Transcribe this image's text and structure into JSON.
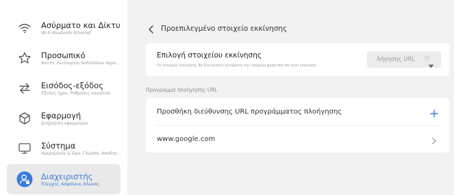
{
  "sidebar": {
    "items": [
      {
        "title": "Ασύρματο και Δίκτυο",
        "subtitle": "Wi-Fi Bluetooth Ethernet",
        "icon": "wifi-icon"
      },
      {
        "title": "Προσωπικό",
        "subtitle": "Φόντο, Λειτουργία πολλαπλών παρα...",
        "icon": "star-icon"
      },
      {
        "title": "Εισόδος-εξόδος",
        "subtitle": "Έξοδος ήχου, Ρυθμίσεις καναλιού",
        "icon": "swap-arrows-icon"
      },
      {
        "title": "Εφαρμογή",
        "subtitle": "Διαχείριση εφαρμογών",
        "icon": "cube-icon"
      },
      {
        "title": "Σύστημα",
        "subtitle": "Ημερομηνία & Ώρα, Γλώσσα, Αποθήκ...",
        "icon": "monitor-icon"
      },
      {
        "title": "Διαχειριστής",
        "subtitle": "Έλεγχος, Ασφάλεια, Κλώνος",
        "icon": "admin-user-icon",
        "active": true
      }
    ]
  },
  "header": {
    "title": "Προεπιλεγμένο στοιχείο εκκίνησης"
  },
  "boot": {
    "title": "Επιλογή στοιχείου εκκίνησης",
    "description": "Τα στοιχεία εκκίνησης θα ξεκινήσουν αυτόματα την επόμενη φορά που θα γίνει εκκίνηση",
    "select_value": "λήγησης URL",
    "select_fade": "Π"
  },
  "section": {
    "label": "Πρόγραμμα πλοήγησης URL"
  },
  "list": {
    "add_label": "Προσθήκη διεύθυνσης URL προγράμματος πλοήγησης",
    "url_label": "www.google.com"
  },
  "colors": {
    "accent": "#3a7ad9",
    "background": "#f2f2f2"
  }
}
